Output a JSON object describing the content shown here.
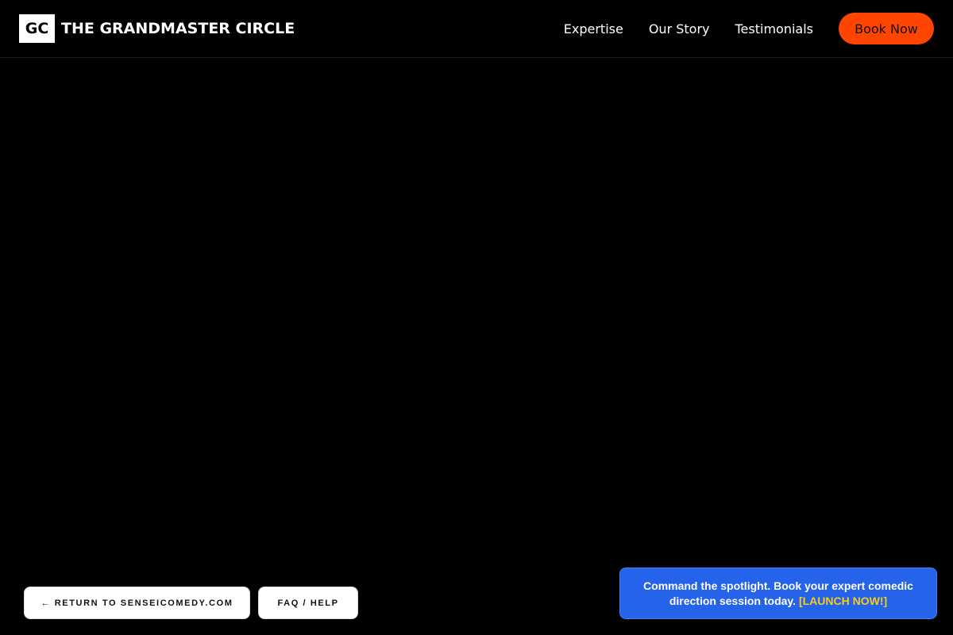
{
  "header": {
    "logo_text": "GC",
    "brand_name": "THE GRANDMASTER CIRCLE",
    "nav": [
      {
        "label": "Expertise"
      },
      {
        "label": "Our Story"
      },
      {
        "label": "Testimonials"
      }
    ],
    "book_label": "Book Now"
  },
  "footer": {
    "return_label": "← RETURN TO SENSEICOMEDY.COM",
    "faq_label": "FAQ / HELP"
  },
  "promo": {
    "text": "Command the spotlight. Book your expert comedic direction session today.",
    "cta": "[LAUNCH NOW!]"
  },
  "colors": {
    "background": "#000000",
    "accent": "#ff4500",
    "promo_bg": "#2563eb",
    "promo_cta": "#facc15"
  }
}
